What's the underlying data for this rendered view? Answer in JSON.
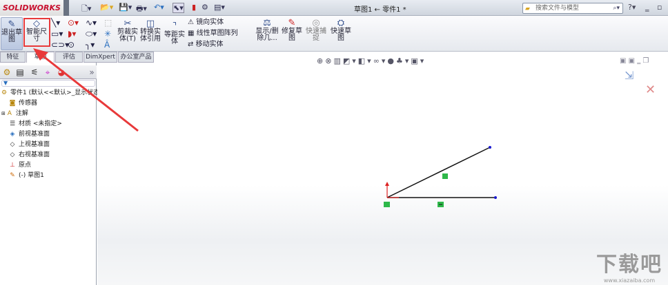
{
  "app": {
    "logo": "SOLIDWORKS",
    "doc_title": "草图1 ← 零件1 *"
  },
  "search": {
    "placeholder": "搜索文件与模型"
  },
  "ribbon": {
    "exit_sketch": "退出草图",
    "smart_dimension": "智能尺寸",
    "trim": "剪裁实体(T)",
    "convert": "转换实体引用",
    "offset": "等距实体",
    "mirror": "镜向实体",
    "linear_pattern": "线性草图阵列",
    "move": "移动实体",
    "display_delete": "显示/删除几...",
    "repair": "修复草图",
    "quick_snaps": "快速捕捉",
    "rapid_sketch": "快速草图"
  },
  "tabs": [
    "特征",
    "草图",
    "评估",
    "DimXpert",
    "办公室产品"
  ],
  "active_tab": "草图",
  "tree": {
    "root": "零件1 (默认<<默认>_显示状态",
    "items": [
      "传感器",
      "注解",
      "材质 <未指定>",
      "前视基准面",
      "上视基准面",
      "右视基准面",
      "原点",
      "(-) 草图1"
    ]
  },
  "watermark": {
    "text": "下载吧",
    "url": "www.xiazaiba.com"
  },
  "colors": {
    "annotation": "#e8393a",
    "sketch_line": "#111111",
    "point": "#1a1ad0"
  }
}
